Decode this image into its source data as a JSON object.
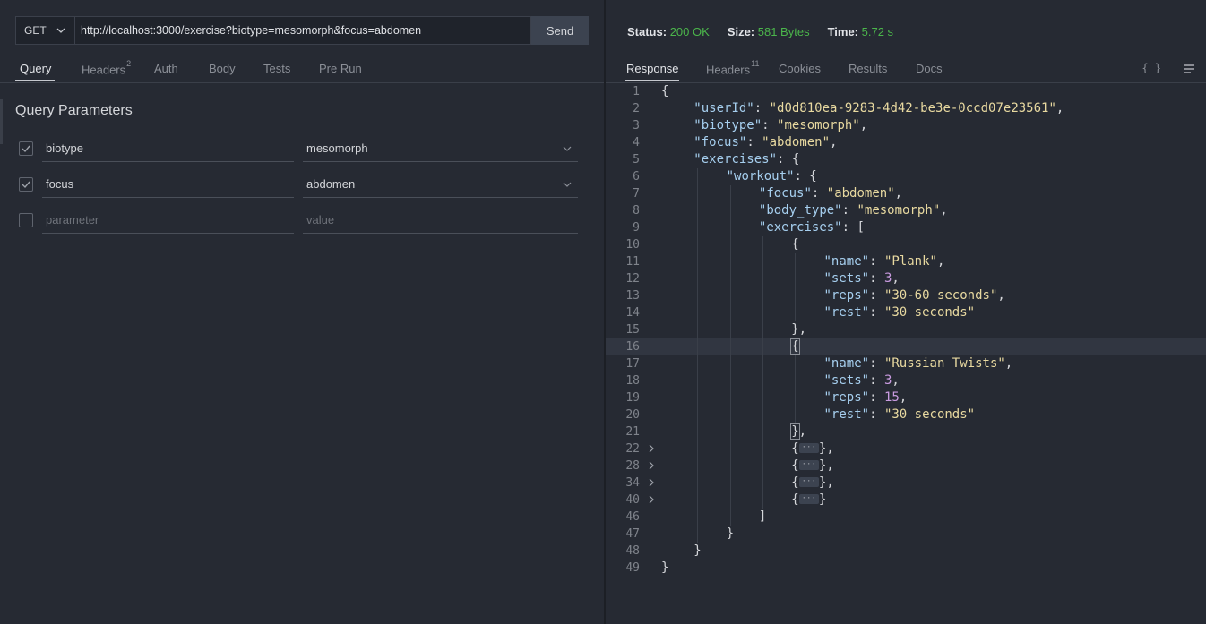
{
  "request": {
    "method": "GET",
    "url": "http://localhost:3000/exercise?biotype=mesomorph&focus=abdomen",
    "send_label": "Send"
  },
  "request_tabs": [
    {
      "label": "Query",
      "badge": ""
    },
    {
      "label": "Headers",
      "badge": "2"
    },
    {
      "label": "Auth",
      "badge": ""
    },
    {
      "label": "Body",
      "badge": ""
    },
    {
      "label": "Tests",
      "badge": ""
    },
    {
      "label": "Pre Run",
      "badge": ""
    }
  ],
  "query": {
    "title": "Query Parameters",
    "params": [
      {
        "name": "biotype",
        "value": "mesomorph",
        "checked": true
      },
      {
        "name": "focus",
        "value": "abdomen",
        "checked": true
      }
    ],
    "new_param": {
      "name_placeholder": "parameter",
      "value_placeholder": "value"
    }
  },
  "response_status": {
    "status_label": "Status:",
    "status_value": "200 OK",
    "size_label": "Size:",
    "size_value": "581 Bytes",
    "time_label": "Time:",
    "time_value": "5.72 s",
    "value_color": "#4bb54b"
  },
  "response_tabs": [
    {
      "label": "Response",
      "badge": ""
    },
    {
      "label": "Headers",
      "badge": "11"
    },
    {
      "label": "Cookies",
      "badge": ""
    },
    {
      "label": "Results",
      "badge": ""
    },
    {
      "label": "Docs",
      "badge": ""
    }
  ],
  "response_icons": {
    "braces": "{ }",
    "wrap": "wrap-lines-icon"
  },
  "code_lines": [
    {
      "n": "1",
      "indent": 0,
      "parts": [
        [
          "p",
          "{"
        ]
      ]
    },
    {
      "n": "2",
      "indent": 1,
      "parts": [
        [
          "k",
          "\"userId\""
        ],
        [
          "p",
          ": "
        ],
        [
          "s",
          "\"d0d810ea-9283-4d42-be3e-0ccd07e23561\""
        ],
        [
          "p",
          ","
        ]
      ]
    },
    {
      "n": "3",
      "indent": 1,
      "parts": [
        [
          "k",
          "\"biotype\""
        ],
        [
          "p",
          ": "
        ],
        [
          "s",
          "\"mesomorph\""
        ],
        [
          "p",
          ","
        ]
      ]
    },
    {
      "n": "4",
      "indent": 1,
      "parts": [
        [
          "k",
          "\"focus\""
        ],
        [
          "p",
          ": "
        ],
        [
          "s",
          "\"abdomen\""
        ],
        [
          "p",
          ","
        ]
      ]
    },
    {
      "n": "5",
      "indent": 1,
      "parts": [
        [
          "k",
          "\"exercises\""
        ],
        [
          "p",
          ": {"
        ]
      ]
    },
    {
      "n": "6",
      "indent": 2,
      "parts": [
        [
          "k",
          "\"workout\""
        ],
        [
          "p",
          ": {"
        ]
      ]
    },
    {
      "n": "7",
      "indent": 3,
      "parts": [
        [
          "k",
          "\"focus\""
        ],
        [
          "p",
          ": "
        ],
        [
          "s",
          "\"abdomen\""
        ],
        [
          "p",
          ","
        ]
      ]
    },
    {
      "n": "8",
      "indent": 3,
      "parts": [
        [
          "k",
          "\"body_type\""
        ],
        [
          "p",
          ": "
        ],
        [
          "s",
          "\"mesomorph\""
        ],
        [
          "p",
          ","
        ]
      ]
    },
    {
      "n": "9",
      "indent": 3,
      "parts": [
        [
          "k",
          "\"exercises\""
        ],
        [
          "p",
          ": ["
        ]
      ]
    },
    {
      "n": "10",
      "indent": 4,
      "parts": [
        [
          "p",
          "{"
        ]
      ]
    },
    {
      "n": "11",
      "indent": 5,
      "parts": [
        [
          "k",
          "\"name\""
        ],
        [
          "p",
          ": "
        ],
        [
          "s",
          "\"Plank\""
        ],
        [
          "p",
          ","
        ]
      ]
    },
    {
      "n": "12",
      "indent": 5,
      "parts": [
        [
          "k",
          "\"sets\""
        ],
        [
          "p",
          ": "
        ],
        [
          "n",
          "3"
        ],
        [
          "p",
          ","
        ]
      ]
    },
    {
      "n": "13",
      "indent": 5,
      "parts": [
        [
          "k",
          "\"reps\""
        ],
        [
          "p",
          ": "
        ],
        [
          "s",
          "\"30-60 seconds\""
        ],
        [
          "p",
          ","
        ]
      ]
    },
    {
      "n": "14",
      "indent": 5,
      "parts": [
        [
          "k",
          "\"rest\""
        ],
        [
          "p",
          ": "
        ],
        [
          "s",
          "\"30 seconds\""
        ]
      ]
    },
    {
      "n": "15",
      "indent": 4,
      "parts": [
        [
          "p",
          "},"
        ]
      ]
    },
    {
      "n": "16",
      "indent": 4,
      "parts": [
        [
          "c",
          "{"
        ]
      ],
      "highlight": true
    },
    {
      "n": "17",
      "indent": 5,
      "parts": [
        [
          "k",
          "\"name\""
        ],
        [
          "p",
          ": "
        ],
        [
          "s",
          "\"Russian Twists\""
        ],
        [
          "p",
          ","
        ]
      ]
    },
    {
      "n": "18",
      "indent": 5,
      "parts": [
        [
          "k",
          "\"sets\""
        ],
        [
          "p",
          ": "
        ],
        [
          "n",
          "3"
        ],
        [
          "p",
          ","
        ]
      ]
    },
    {
      "n": "19",
      "indent": 5,
      "parts": [
        [
          "k",
          "\"reps\""
        ],
        [
          "p",
          ": "
        ],
        [
          "n",
          "15"
        ],
        [
          "p",
          ","
        ]
      ]
    },
    {
      "n": "20",
      "indent": 5,
      "parts": [
        [
          "k",
          "\"rest\""
        ],
        [
          "p",
          ": "
        ],
        [
          "s",
          "\"30 seconds\""
        ]
      ]
    },
    {
      "n": "21",
      "indent": 4,
      "parts": [
        [
          "c",
          "}"
        ],
        [
          "p",
          ","
        ]
      ]
    },
    {
      "n": "22",
      "indent": 4,
      "fold": true,
      "parts": [
        [
          "p",
          "{"
        ],
        [
          "e",
          "···"
        ],
        [
          "p",
          "},"
        ]
      ]
    },
    {
      "n": "28",
      "indent": 4,
      "fold": true,
      "parts": [
        [
          "p",
          "{"
        ],
        [
          "e",
          "···"
        ],
        [
          "p",
          "},"
        ]
      ]
    },
    {
      "n": "34",
      "indent": 4,
      "fold": true,
      "parts": [
        [
          "p",
          "{"
        ],
        [
          "e",
          "···"
        ],
        [
          "p",
          "},"
        ]
      ]
    },
    {
      "n": "40",
      "indent": 4,
      "fold": true,
      "parts": [
        [
          "p",
          "{"
        ],
        [
          "e",
          "···"
        ],
        [
          "p",
          "}"
        ]
      ]
    },
    {
      "n": "46",
      "indent": 3,
      "parts": [
        [
          "p",
          "]"
        ]
      ]
    },
    {
      "n": "47",
      "indent": 2,
      "parts": [
        [
          "p",
          "}"
        ]
      ]
    },
    {
      "n": "48",
      "indent": 1,
      "parts": [
        [
          "p",
          "}"
        ]
      ]
    },
    {
      "n": "49",
      "indent": 0,
      "parts": [
        [
          "p",
          "}"
        ]
      ]
    }
  ]
}
